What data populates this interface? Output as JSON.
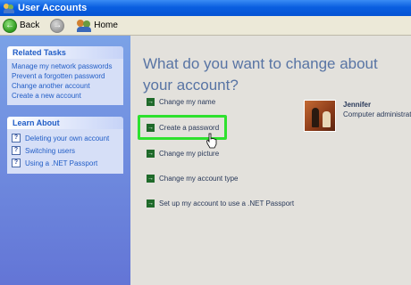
{
  "window": {
    "title": "User Accounts"
  },
  "toolbar": {
    "back_label": "Back",
    "home_label": "Home"
  },
  "sidebar": {
    "related_tasks": {
      "title": "Related Tasks",
      "items": [
        "Manage my network passwords",
        "Prevent a forgotten password",
        "Change another account",
        "Create a new account"
      ]
    },
    "learn_about": {
      "title": "Learn About",
      "items": [
        "Deleting your own account",
        "Switching users",
        "Using a .NET Passport"
      ]
    }
  },
  "main": {
    "heading": "What do you want to change about your account?",
    "options": [
      "Change my name",
      "Create a password",
      "Change my picture",
      "Change my account type",
      "Set up my account to use a .NET Passport"
    ],
    "highlight_color": "#2ee12e"
  },
  "user": {
    "name": "Jennifer",
    "role": "Computer administrator"
  }
}
